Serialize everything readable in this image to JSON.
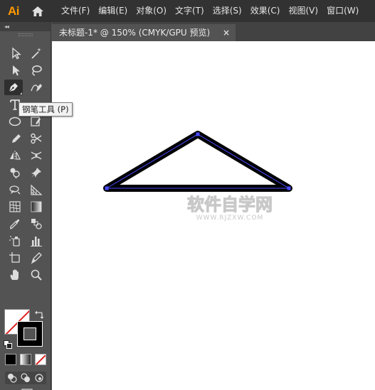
{
  "app": {
    "logo_text": "Ai",
    "menu": [
      "文件(F)",
      "编辑(E)",
      "对象(O)",
      "文字(T)",
      "选择(S)",
      "效果(C)",
      "视图(V)",
      "窗口(W)"
    ]
  },
  "document": {
    "tab_title": "未标题-1* @ 150% (CMYK/GPU 预览)",
    "close_symbol": "×"
  },
  "toolbar": {
    "collapse_symbol": "◂◂",
    "tooltip": "钢笔工具 (P)",
    "active_tool": "pen-tool"
  },
  "watermark": {
    "main": "软件自学网",
    "sub": "WWW.RJZXW.COM"
  },
  "colors": {
    "ui_dark": "#323232",
    "panel": "#535353",
    "accent_logo": "#ff9a00",
    "path_selection": "#4a4aff",
    "stroke": "#000000",
    "fill": "#ffffff"
  }
}
